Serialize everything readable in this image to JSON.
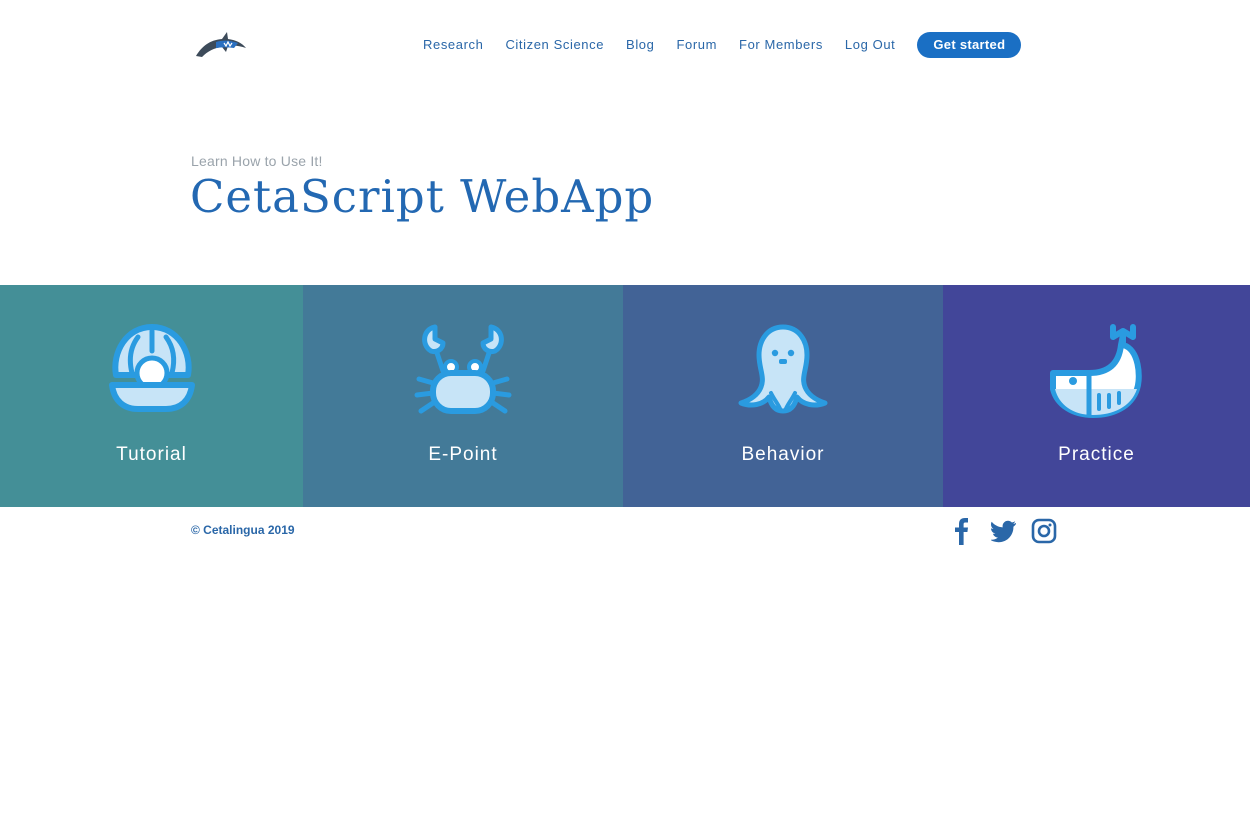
{
  "nav": {
    "items": [
      "Research",
      "Citizen Science",
      "Blog",
      "Forum",
      "For Members",
      "Log Out"
    ],
    "cta_label": "Get started"
  },
  "hero": {
    "kicker": "Learn How to Use It!",
    "title": "CetaScript WebApp"
  },
  "tiles": [
    {
      "label": "Tutorial",
      "icon": "clam-pearl-icon",
      "color": "#448f97"
    },
    {
      "label": "E-Point",
      "icon": "crab-icon",
      "color": "#437a98"
    },
    {
      "label": "Behavior",
      "icon": "octopus-icon",
      "color": "#426396"
    },
    {
      "label": "Practice",
      "icon": "whale-icon",
      "color": "#424699"
    }
  ],
  "footer": {
    "copyright": "© Cetalingua 2019",
    "social": [
      "facebook-icon",
      "twitter-icon",
      "instagram-icon"
    ]
  },
  "colors": {
    "brand_blue": "#2368b2",
    "cta_blue": "#1a6fc4",
    "icon_blue": "#2a9be0",
    "icon_fill": "#c7e4f7"
  }
}
